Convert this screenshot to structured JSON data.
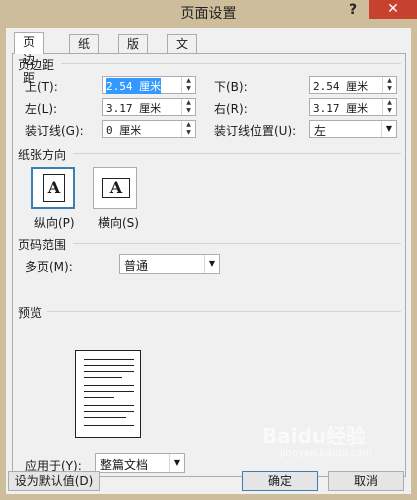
{
  "window": {
    "title": "页面设置",
    "help": "?",
    "close": "✕"
  },
  "tabs": [
    {
      "label": "页边距",
      "active": true
    },
    {
      "label": "纸张",
      "active": false
    },
    {
      "label": "版式",
      "active": false
    },
    {
      "label": "文档网格",
      "active": false
    }
  ],
  "margins": {
    "section_title": "页边距",
    "top_label": "上(T):",
    "top_value": "2.54 厘米",
    "bottom_label": "下(B):",
    "bottom_value": "2.54 厘米",
    "left_label": "左(L):",
    "left_value": "3.17 厘米",
    "right_label": "右(R):",
    "right_value": "3.17 厘米",
    "gutter_label": "装订线(G):",
    "gutter_value": "0 厘米",
    "gutter_pos_label": "装订线位置(U):",
    "gutter_pos_value": "左"
  },
  "orientation": {
    "section_title": "纸张方向",
    "glyph": "A",
    "portrait_label": "纵向(P)",
    "landscape_label": "横向(S)",
    "selected": "portrait"
  },
  "pages": {
    "section_title": "页码范围",
    "multi_label": "多页(M):",
    "multi_value": "普通"
  },
  "preview": {
    "section_title": "预览"
  },
  "apply": {
    "label": "应用于(Y):",
    "value": "整篇文档"
  },
  "buttons": {
    "default": "设为默认值(D)",
    "ok": "确定",
    "cancel": "取消"
  },
  "watermark": {
    "text": "Baidu经验",
    "sub": "jingyan.baidu.com"
  }
}
